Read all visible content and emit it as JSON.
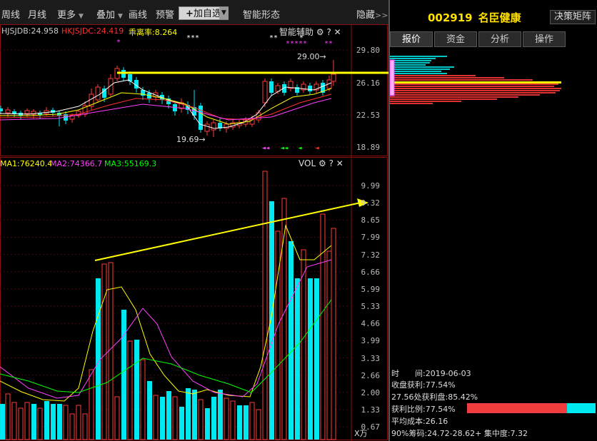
{
  "toolbar": {
    "items": [
      "周线",
      "月线",
      "更多",
      "叠加",
      "画线",
      "预警"
    ],
    "add_label": "加自选",
    "smart": "智能形态",
    "hide": "隐藏"
  },
  "stock": {
    "code": "002919",
    "name": "名臣健康"
  },
  "decision_button": "决策矩阵",
  "tabs": [
    "报价",
    "资金",
    "分析",
    "操作"
  ],
  "price_panel": {
    "indicators": [
      {
        "text": "HJSJDB:24.958",
        "color": "#ffffff"
      },
      {
        "text": "HKJSJDC:24.419",
        "color": "#ff3030"
      },
      {
        "text": "乖离率:8.264",
        "color": "#ffff00"
      }
    ],
    "tools_label": "智能辅助",
    "y_ticks": [
      "29.80",
      "26.16",
      "22.53",
      "18.89"
    ],
    "high_label": "29.00→",
    "low_label": "19.69→"
  },
  "volume_panel": {
    "indicators": [
      {
        "text": "MA1:76240.4",
        "color": "#ffff00"
      },
      {
        "text": "MA2:74366.7",
        "color": "#ff40ff"
      },
      {
        "text": "MA3:55169.3",
        "color": "#00ff00"
      }
    ],
    "tools_label": "VOL",
    "y_ticks": [
      "9.99",
      "9.32",
      "8.65",
      "7.99",
      "7.32",
      "6.66",
      "5.99",
      "5.33",
      "4.66",
      "3.99",
      "3.33",
      "2.66",
      "2.00",
      "1.33",
      "0.67"
    ],
    "unit": "X万"
  },
  "chip_info": {
    "time_label": "时",
    "time_label2": "间:",
    "time_value": "2019-06-03",
    "close_profit": "收盘获利:77.54%",
    "profit_at": "27.56处获利盘:85.42%",
    "profit_ratio": "获利比例:77.54%",
    "profit_ratio_value": 0.7754,
    "avg_cost": "平均成本:26.16",
    "chips90": "90%筹码:24.72-28.62+ 集中度:7.32"
  },
  "colors": {
    "up": "#ff3c3c",
    "down": "#00e8f0",
    "highlight": "#ffff00"
  }
}
